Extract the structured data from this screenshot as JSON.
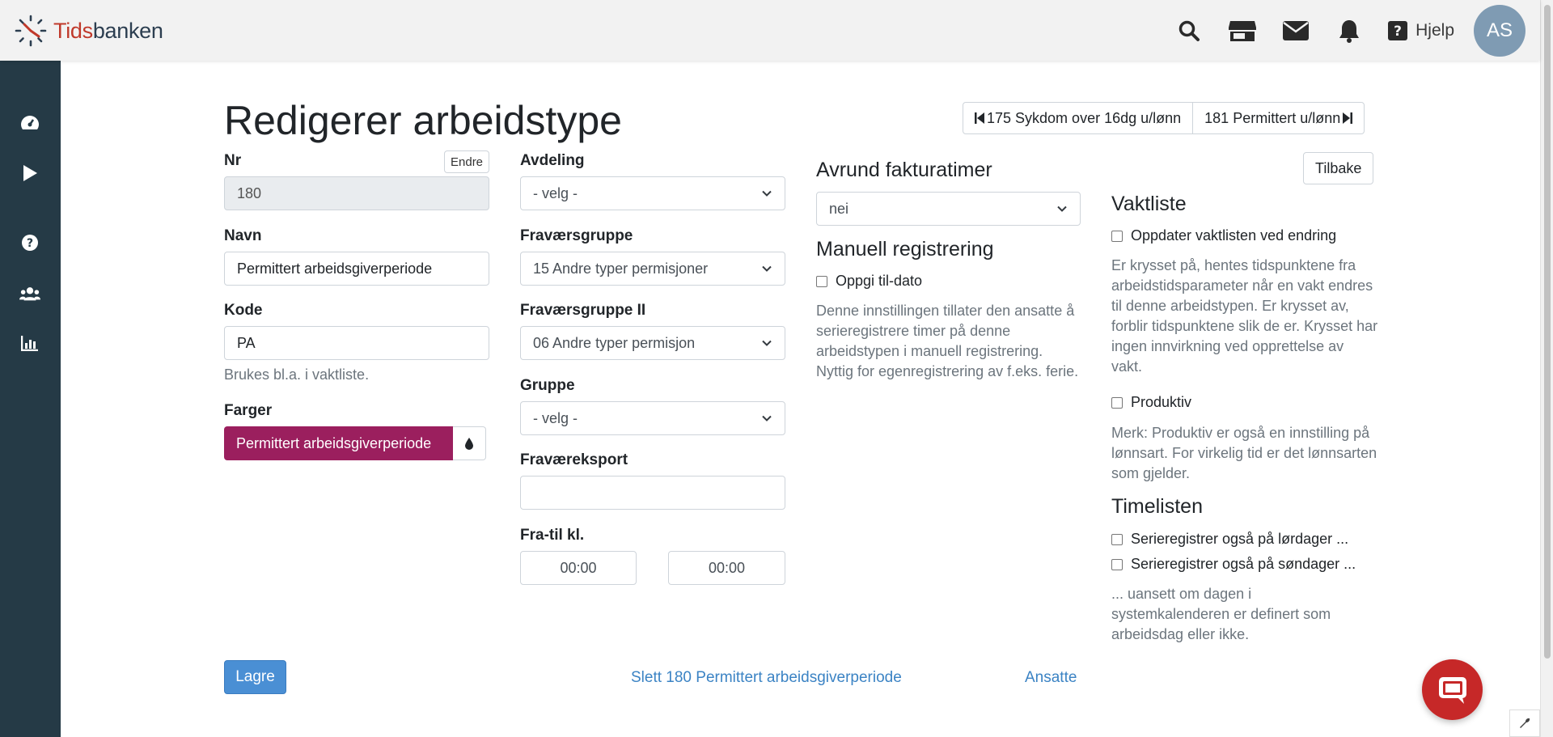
{
  "brand": {
    "part1": "Tids",
    "part2": "banken"
  },
  "header": {
    "help_label": "Hjelp",
    "avatar_initials": "AS"
  },
  "page": {
    "title": "Redigerer arbeidstype"
  },
  "nav": {
    "prev_label": "175 Sykdom over 16dg u/lønn",
    "next_label": "181 Permittert u/lønn"
  },
  "form": {
    "nr": {
      "label": "Nr",
      "value": "180",
      "edit_label": "Endre"
    },
    "navn": {
      "label": "Navn",
      "value": "Permittert arbeidsgiverperiode"
    },
    "kode": {
      "label": "Kode",
      "value": "PA",
      "hint": "Brukes bl.a. i vaktliste."
    },
    "farger": {
      "label": "Farger",
      "value": "Permittert arbeidsgiverperiode",
      "color": "#9b1f5e"
    },
    "avdeling": {
      "label": "Avdeling",
      "value": "- velg -"
    },
    "fravaersgruppe": {
      "label": "Fraværsgruppe",
      "value": "15 Andre typer permisjoner"
    },
    "fravaersgruppe2": {
      "label": "Fraværsgruppe II",
      "value": "06 Andre typer permisjon"
    },
    "gruppe": {
      "label": "Gruppe",
      "value": "- velg -"
    },
    "fravaereksport": {
      "label": "Fraværeksport",
      "value": ""
    },
    "fratil": {
      "label": "Fra-til kl.",
      "from": "00:00",
      "to": "00:00"
    }
  },
  "avrund": {
    "title": "Avrund fakturatimer",
    "value": "nei"
  },
  "manuell": {
    "title": "Manuell registrering",
    "checkbox_label": "Oppgi til-dato",
    "description": "Denne innstillingen tillater den ansatte å serieregistrere timer på denne arbeidstypen i manuell registrering. Nyttig for egenregistrering av f.eks. ferie."
  },
  "vaktliste": {
    "back_label": "Tilbake",
    "title": "Vaktliste",
    "checkbox_label": "Oppdater vaktlisten ved endring",
    "description": "Er krysset på, hentes tidspunktene fra arbeidstidsparameter når en vakt endres til denne arbeidstypen. Er krysset av, forblir tidspunktene slik de er. Krysset har ingen innvirkning ved opprettelse av vakt.",
    "produktiv_label": "Produktiv",
    "produktiv_note": "Merk: Produktiv er også en innstilling på lønnsart. For virkelig tid er det lønnsarten som gjelder."
  },
  "timelisten": {
    "title": "Timelisten",
    "saturday_label": "Serieregistrer også på lørdager ...",
    "sunday_label": "Serieregistrer også på søndager ...",
    "note": "... uansett om dagen i systemkalenderen er definert som arbeidsdag eller ikke."
  },
  "actions": {
    "save_label": "Lagre",
    "delete_label": "Slett 180 Permittert arbeidsgiverperiode",
    "employees_label": "Ansatte"
  }
}
